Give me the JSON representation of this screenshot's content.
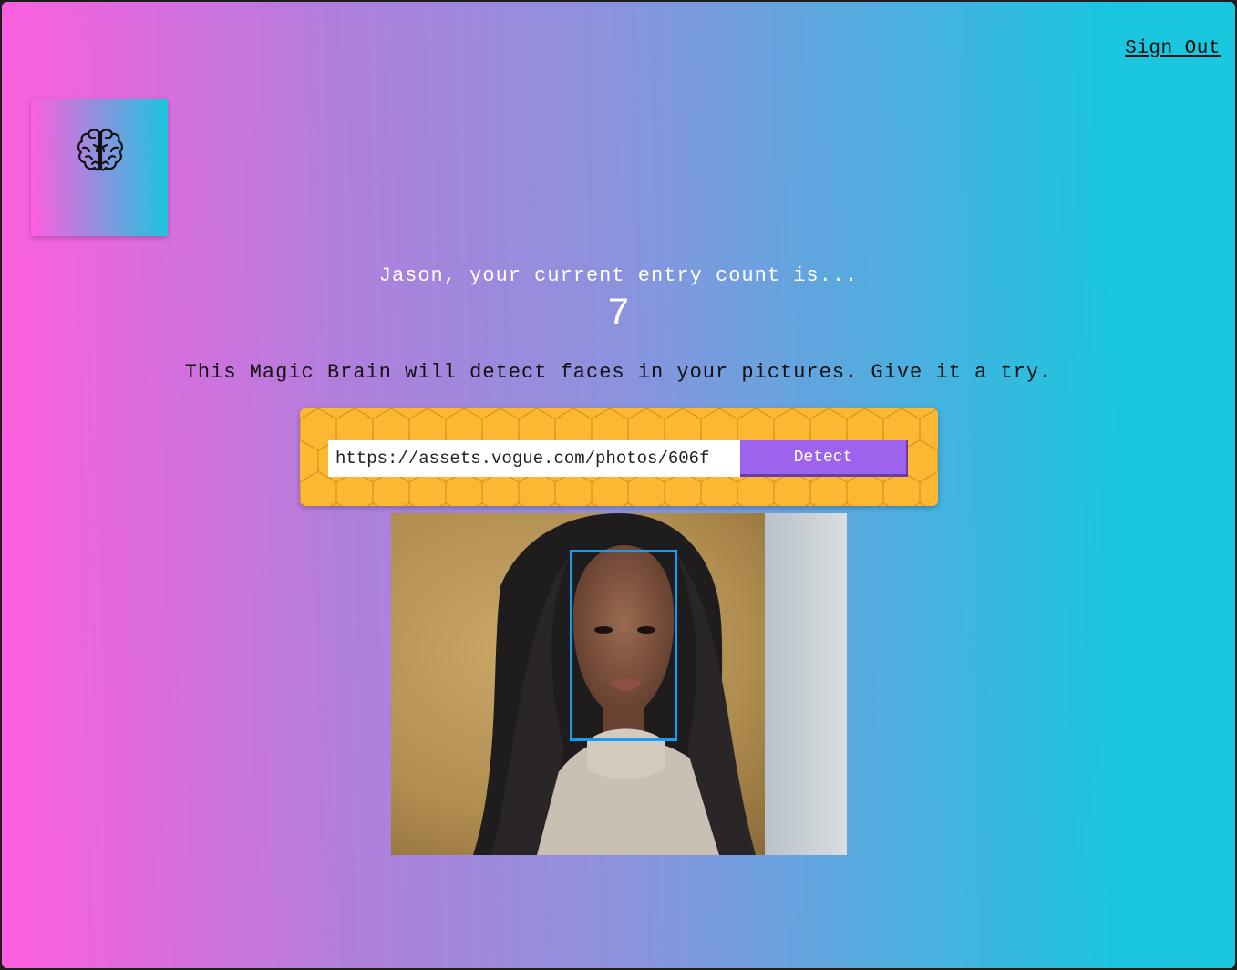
{
  "header": {
    "sign_out_label": "Sign Out"
  },
  "logo": {
    "icon": "brain-icon"
  },
  "rank": {
    "message": "Jason, your current entry count is...",
    "count": "7"
  },
  "description": "This Magic Brain will detect faces in your pictures. Give it a try.",
  "image_form": {
    "url_value": "https://assets.vogue.com/photos/606f",
    "button_label": "Detect"
  },
  "colors": {
    "gradient_start": "#ff5edf",
    "gradient_end": "#1ac6df",
    "form_background": "#fdb833",
    "button": "#9e63ec",
    "face_box": "#149df2"
  }
}
